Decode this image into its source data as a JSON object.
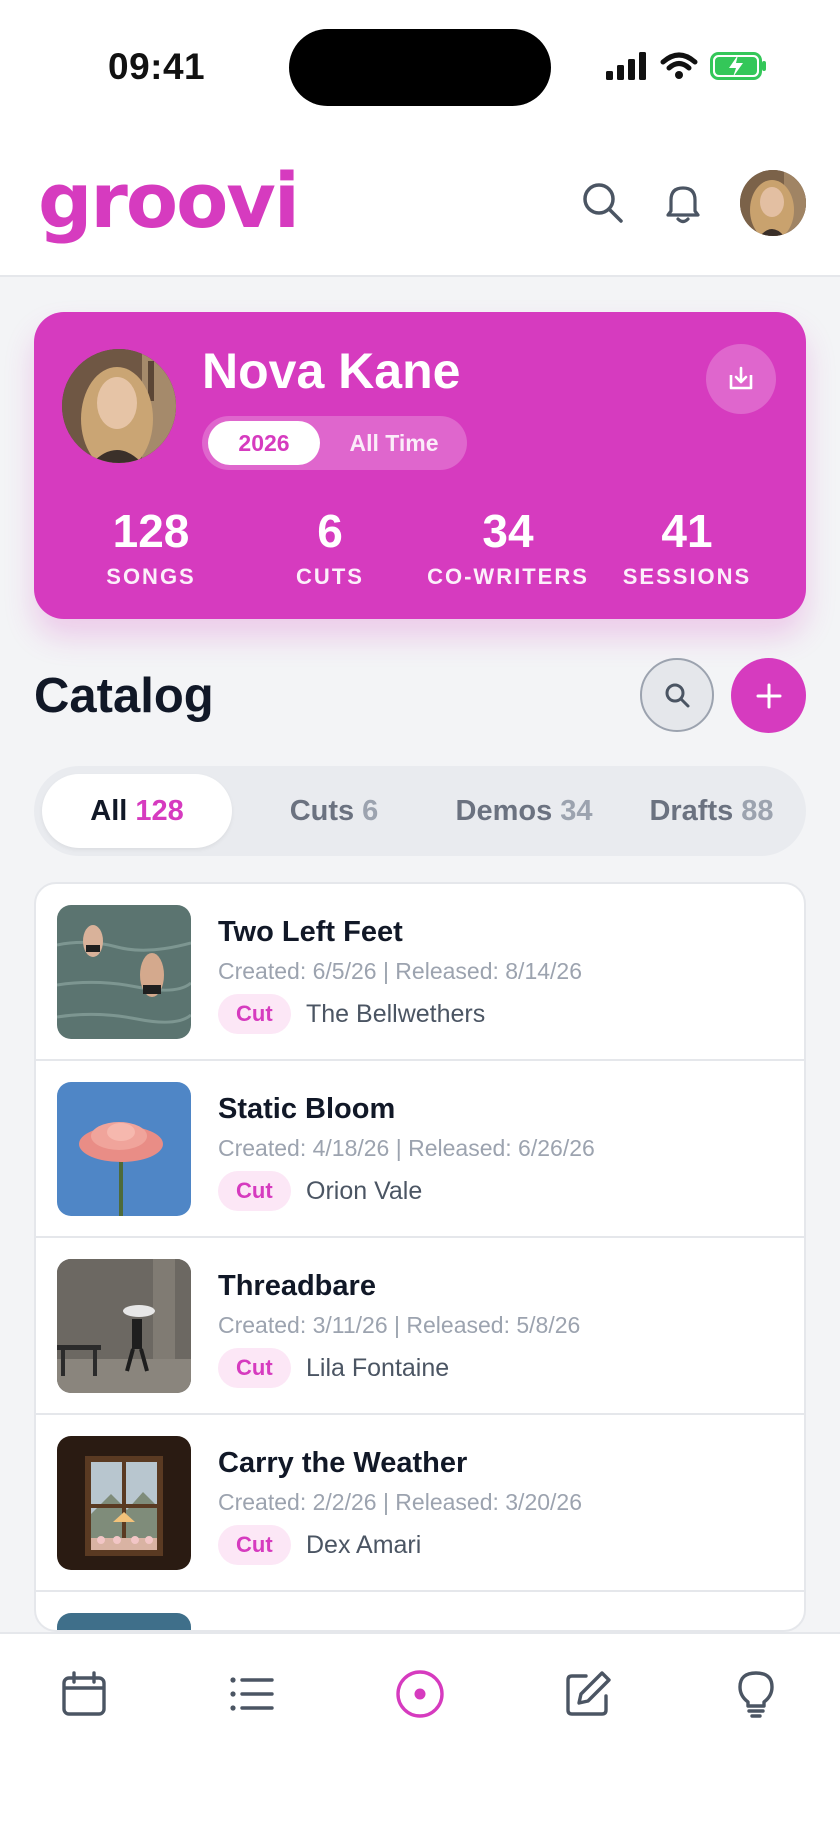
{
  "status": {
    "time": "09:41"
  },
  "app": {
    "logo": "groovi"
  },
  "profile": {
    "name": "Nova Kane",
    "period_options": [
      "2026",
      "All Time"
    ],
    "period_selected": "2026",
    "stats": [
      {
        "value": "128",
        "label": "SONGS"
      },
      {
        "value": "6",
        "label": "CUTS"
      },
      {
        "value": "34",
        "label": "CO-WRITERS"
      },
      {
        "value": "41",
        "label": "SESSIONS"
      }
    ]
  },
  "catalog": {
    "title": "Catalog",
    "tabs": [
      {
        "label": "All",
        "count": "128",
        "active": true
      },
      {
        "label": "Cuts",
        "count": "6"
      },
      {
        "label": "Demos",
        "count": "34"
      },
      {
        "label": "Drafts",
        "count": "88"
      }
    ],
    "songs": [
      {
        "title": "Two Left Feet",
        "meta": "Created: 6/5/26 | Released: 8/14/26",
        "badge": "Cut",
        "artist": "The Bellwethers"
      },
      {
        "title": "Static Bloom",
        "meta": "Created: 4/18/26 | Released: 6/26/26",
        "badge": "Cut",
        "artist": "Orion Vale"
      },
      {
        "title": "Threadbare",
        "meta": "Created: 3/11/26 | Released: 5/8/26",
        "badge": "Cut",
        "artist": "Lila Fontaine"
      },
      {
        "title": "Carry the Weather",
        "meta": "Created: 2/2/26 | Released: 3/20/26",
        "badge": "Cut",
        "artist": "Dex Amari"
      }
    ]
  },
  "colors": {
    "accent": "#d63bbf",
    "accent_light": "#fce7f6",
    "battery": "#34c759"
  },
  "nav": [
    "calendar-icon",
    "list-icon",
    "disc-icon",
    "edit-icon",
    "lightbulb-icon"
  ]
}
